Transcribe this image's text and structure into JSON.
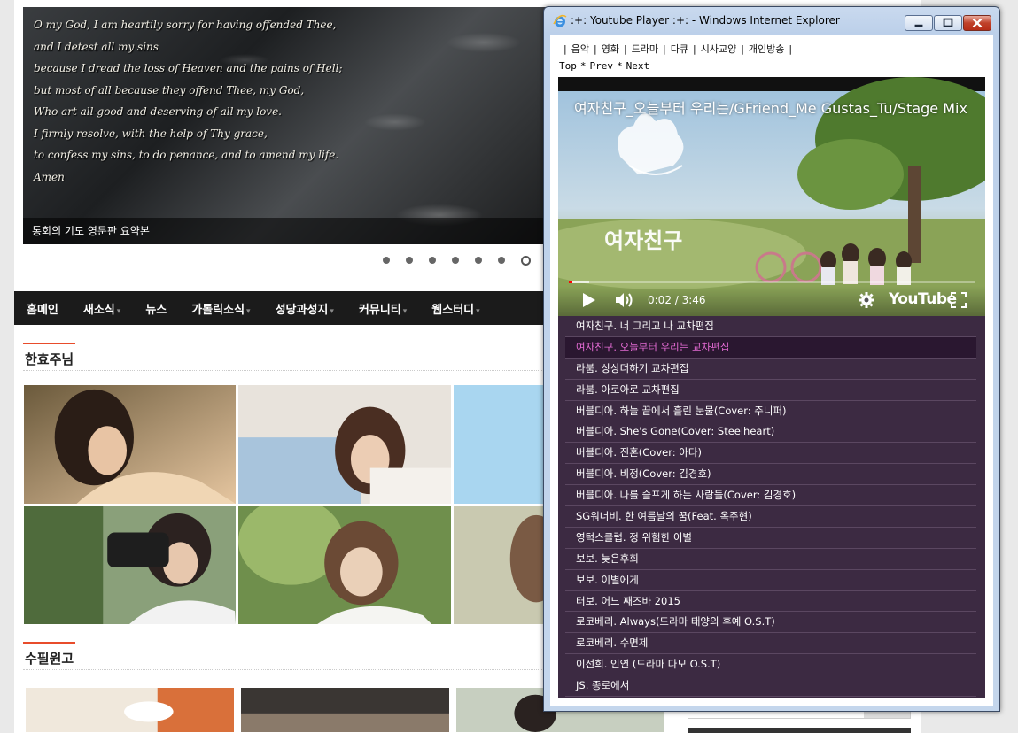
{
  "page": {
    "prayer_lines": [
      "O my God, I am heartily sorry for having offended Thee,",
      "and I detest all my sins",
      "because I dread the loss of Heaven and the pains of Hell;",
      "but most of all because they offend Thee, my God,",
      "Who art all-good and deserving of all my love.",
      "I firmly resolve, with the help of Thy grace,",
      "to confess my sins, to do penance, and to amend my life.",
      "Amen"
    ],
    "slider_caption": "통회의 기도 영문판 요약본",
    "slider_dot_count": 7,
    "slider_active_dot": 7,
    "nav": [
      {
        "label": "홈메인",
        "has_dropdown": false
      },
      {
        "label": "새소식",
        "has_dropdown": true
      },
      {
        "label": "뉴스",
        "has_dropdown": false
      },
      {
        "label": "가톨릭소식",
        "has_dropdown": true
      },
      {
        "label": "성당과성지",
        "has_dropdown": true
      },
      {
        "label": "커뮤니티",
        "has_dropdown": true
      },
      {
        "label": "웹스터디",
        "has_dropdown": true
      }
    ],
    "dropdown_caret": "▾",
    "section1_title": "한효주님",
    "section2_title": "수필원고"
  },
  "ie_window": {
    "title": ":+: Youtube Player :+: - Windows Internet Explorer",
    "controls": [
      "minimize-icon",
      "maximize-icon",
      "close-icon"
    ],
    "categories": [
      "음악",
      "영화",
      "드라마",
      "다큐",
      "시사교양",
      "개인방송"
    ],
    "separator": "|",
    "nav_links": [
      "Top",
      "Prev",
      "Next"
    ],
    "nav_star": "*",
    "player": {
      "video_title": "여자친구_오늘부터 우리는/GFriend_Me Gustas_Tu/Stage Mix",
      "time": "0:02 / 3:46",
      "progress_fraction": 0.009,
      "buffer_fraction": 0.05,
      "logo": "YouTube",
      "overlay_text": "여자친구"
    },
    "playlist": [
      "여자친구. 너 그리고 나 교차편집",
      "여자친구. 오늘부터 우리는 교차편집",
      "라붐. 상상더하기 교차편집",
      "라붐. 아로아로 교차편집",
      "버블디아. 하늘 끝에서 흘린 눈물(Cover: 주니퍼)",
      "버블디아. She's Gone(Cover: Steelheart)",
      "버블디아. 진혼(Cover: 아다)",
      "버블디아. 비정(Cover: 김경호)",
      "버블디아. 나를 슬프게 하는 사람들(Cover: 김경호)",
      "SG워너비. 한 여름날의 꿈(Feat. 옥주현)",
      "영턱스클럽. 정 위험한 이별",
      "보보. 늦은후회",
      "보보. 이별에게",
      "터보. 어느 째즈바 2015",
      "로코베리. Always(드라마 태양의 후예 O.S.T)",
      "로코베리. 수면제",
      "이선희. 인연 (드라마 다모 O.S.T)",
      "JS. 종로에서"
    ],
    "active_index": 1,
    "colors": {
      "playlist_bg": "#3c2a42",
      "active_bg": "#2a1730",
      "active_text": "#e36bd3",
      "progress": "#ff0000"
    }
  }
}
